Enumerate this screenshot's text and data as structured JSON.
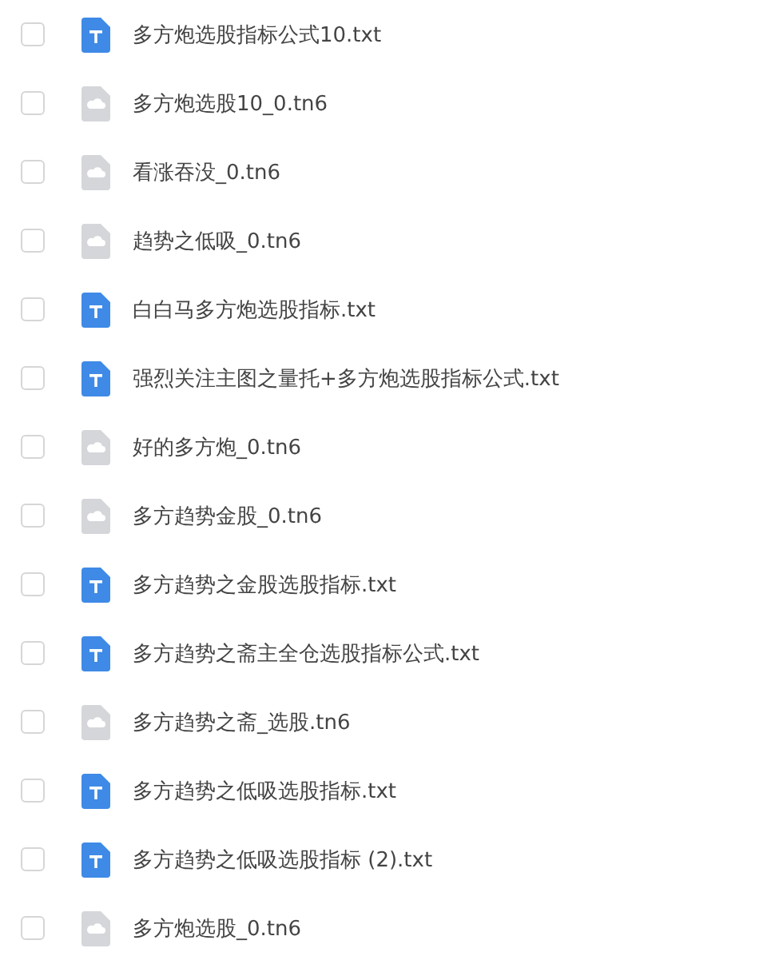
{
  "files": [
    {
      "name": "多方炮选股指标公式10.txt",
      "kind": "text",
      "checked": false
    },
    {
      "name": "多方炮选股10_0.tn6",
      "kind": "cloud",
      "checked": false
    },
    {
      "name": "看涨吞没_0.tn6",
      "kind": "cloud",
      "checked": false
    },
    {
      "name": "趋势之低吸_0.tn6",
      "kind": "cloud",
      "checked": false
    },
    {
      "name": "白白马多方炮选股指标.txt",
      "kind": "text",
      "checked": false
    },
    {
      "name": "强烈关注主图之量托+多方炮选股指标公式.txt",
      "kind": "text",
      "checked": false
    },
    {
      "name": "好的多方炮_0.tn6",
      "kind": "cloud",
      "checked": false
    },
    {
      "name": "多方趋势金股_0.tn6",
      "kind": "cloud",
      "checked": false
    },
    {
      "name": "多方趋势之金股选股指标.txt",
      "kind": "text",
      "checked": false
    },
    {
      "name": "多方趋势之斋主全仓选股指标公式.txt",
      "kind": "text",
      "checked": false
    },
    {
      "name": "多方趋势之斋_选股.tn6",
      "kind": "cloud",
      "checked": false
    },
    {
      "name": "多方趋势之低吸选股指标.txt",
      "kind": "text",
      "checked": false
    },
    {
      "name": "多方趋势之低吸选股指标 (2).txt",
      "kind": "text",
      "checked": false
    },
    {
      "name": "多方炮选股_0.tn6",
      "kind": "cloud",
      "checked": false
    }
  ]
}
